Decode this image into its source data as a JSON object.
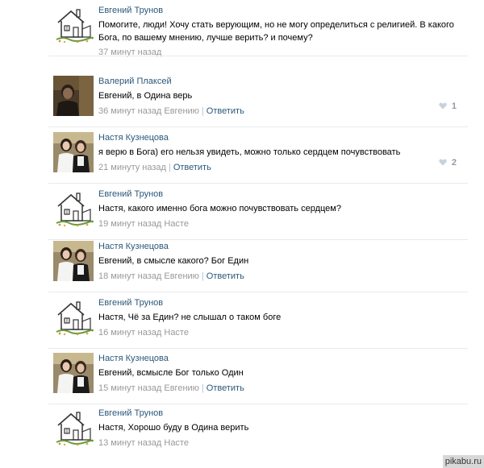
{
  "comments": [
    {
      "author": "Евгений Трунов",
      "avatar": "house-drawing",
      "text": "Помогите, люди! Хочу стать верующим, но не могу определиться с религией. В какого Бога, по вашему мнению, лучше верить? и почему?",
      "time": "37 минут назад",
      "reply_to": "",
      "reply_label": "",
      "likes": ""
    },
    {
      "author": "Валерий Плаксей",
      "avatar": "dark-photo",
      "text": "Евгений, в Одина верь",
      "time": "36 минут назад Евгению",
      "reply_to": "",
      "reply_label": "Ответить",
      "likes": "1"
    },
    {
      "author": "Настя Кузнецова",
      "avatar": "two-girls-photo",
      "text": "я верю в Бога) его нельзя увидеть, можно только сердцем почувствовать",
      "time": "21 минуту назад",
      "reply_to": "",
      "reply_label": "Ответить",
      "likes": "2"
    },
    {
      "author": "Евгений Трунов",
      "avatar": "house-drawing",
      "text": "Настя, какого именно бога можно почувствовать сердцем?",
      "time": "19 минут назад Насте",
      "reply_to": "",
      "reply_label": "",
      "likes": ""
    },
    {
      "author": "Настя Кузнецова",
      "avatar": "two-girls-photo",
      "text": "Евгений, в смысле какого? Бог Един",
      "time": "18 минут назад Евгению",
      "reply_to": "",
      "reply_label": "Ответить",
      "likes": ""
    },
    {
      "author": "Евгений Трунов",
      "avatar": "house-drawing",
      "text": "Настя, Чё за Един? не слышал о таком боге",
      "time": "16 минут назад Насте",
      "reply_to": "",
      "reply_label": "",
      "likes": ""
    },
    {
      "author": "Настя Кузнецова",
      "avatar": "two-girls-photo",
      "text": "Евгений, всмысле Бог только Один",
      "time": "15 минут назад Евгению",
      "reply_to": "",
      "reply_label": "Ответить",
      "likes": ""
    },
    {
      "author": "Евгений Трунов",
      "avatar": "house-drawing",
      "text": "Настя, Хорошо буду в Одина верить",
      "time": "13 минут назад Насте",
      "reply_to": "",
      "reply_label": "",
      "likes": ""
    }
  ],
  "watermark": "pikabu.ru",
  "colors": {
    "author_link": "#2b587a",
    "meta_text": "#999999",
    "likes": "#8f9ba8",
    "divider": "#e7eaed"
  }
}
